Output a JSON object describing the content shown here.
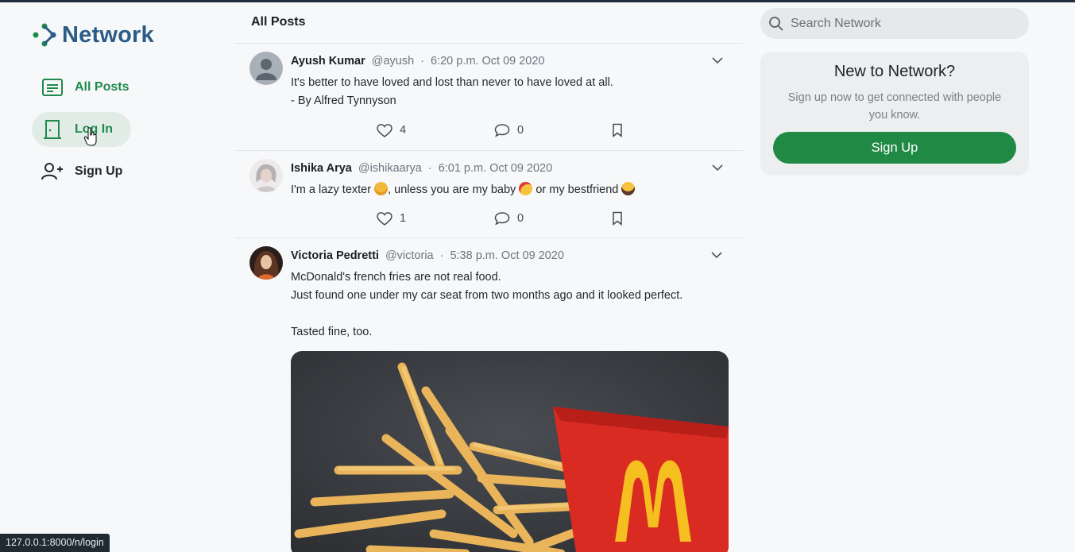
{
  "brand": {
    "name": "Network",
    "accent": "#2b5b86",
    "green": "#1f8a4c"
  },
  "nav": {
    "all_posts": "All Posts",
    "login": "Log In",
    "signup": "Sign Up"
  },
  "feed": {
    "title": "All Posts",
    "posts": [
      {
        "name": "Ayush Kumar",
        "handle": "@ayush",
        "time": "6:20 p.m. Oct 09 2020",
        "text": "It's better to have loved and lost than never to have loved at all.\n- By Alfred Tynnyson",
        "likes": "4",
        "comments": "0"
      },
      {
        "name": "Ishika Arya",
        "handle": "@ishikaarya",
        "time": "6:01 p.m. Oct 09 2020",
        "text_parts": [
          "I'm a lazy texter ",
          ", unless you are my baby ",
          " or my bestfriend "
        ],
        "likes": "1",
        "comments": "0"
      },
      {
        "name": "Victoria Pedretti",
        "handle": "@victoria",
        "time": "5:38 p.m. Oct 09 2020",
        "text": "McDonald's french fries are not real food.\nJust found one under my car seat from two months ago and it looked perfect.\n\nTasted fine, too."
      }
    ]
  },
  "search": {
    "placeholder": "Search Network"
  },
  "card": {
    "title": "New to Network?",
    "subtitle": "Sign up now to get connected with people you know.",
    "button": "Sign Up"
  },
  "status_url": "127.0.0.1:8000/n/login"
}
